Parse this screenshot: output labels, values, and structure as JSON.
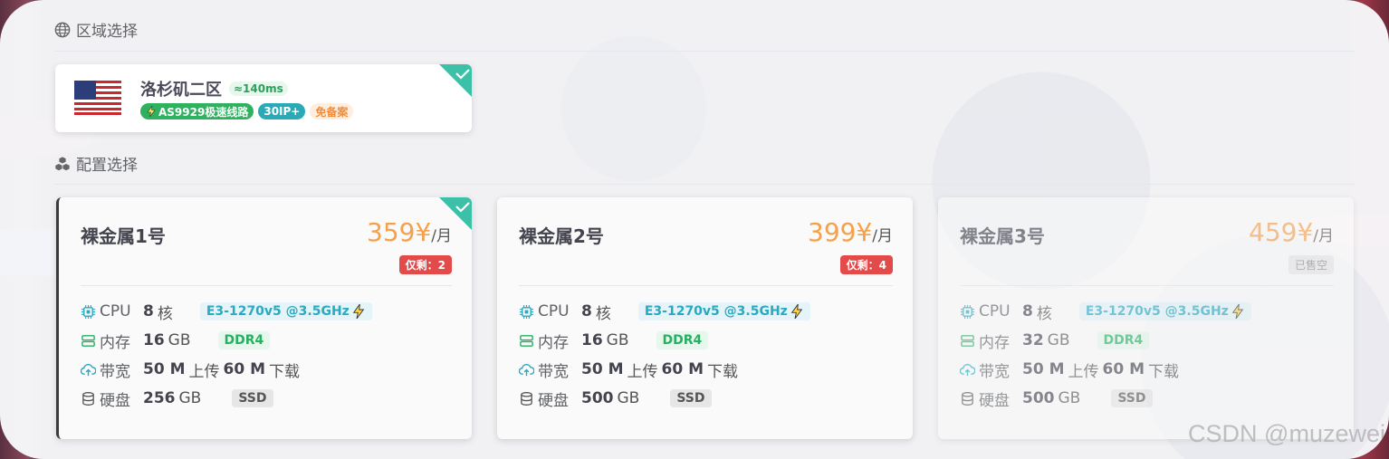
{
  "region_section": {
    "title": "区域选择",
    "icon": "globe-icon"
  },
  "region": {
    "name": "洛杉矶二区",
    "ping": "≈140ms",
    "tags": [
      "AS9929极速线路",
      "30IP+",
      "免备案"
    ],
    "flag": "us-flag"
  },
  "config_section": {
    "title": "配置选择",
    "icon": "cubes-icon"
  },
  "plans": [
    {
      "name": "裸金属1号",
      "price": "359¥",
      "unit": "/月",
      "stock": "仅剩：2",
      "cpu_label": "CPU",
      "cpu_val": "8",
      "cpu_unit": "核",
      "cpu_model": "E3-1270v5 @3.5GHz",
      "mem_label": "内存",
      "mem_val": "16",
      "mem_unit": "GB",
      "mem_type": "DDR4",
      "bw_label": "带宽",
      "bw_up": "50 M",
      "bw_up_text": "上传",
      "bw_down": "60 M",
      "bw_down_text": "下载",
      "disk_label": "硬盘",
      "disk_val": "256",
      "disk_unit": "GB",
      "disk_type": "SSD"
    },
    {
      "name": "裸金属2号",
      "price": "399¥",
      "unit": "/月",
      "stock": "仅剩：4",
      "cpu_label": "CPU",
      "cpu_val": "8",
      "cpu_unit": "核",
      "cpu_model": "E3-1270v5 @3.5GHz",
      "mem_label": "内存",
      "mem_val": "16",
      "mem_unit": "GB",
      "mem_type": "DDR4",
      "bw_label": "带宽",
      "bw_up": "50 M",
      "bw_up_text": "上传",
      "bw_down": "60 M",
      "bw_down_text": "下载",
      "disk_label": "硬盘",
      "disk_val": "500",
      "disk_unit": "GB",
      "disk_type": "SSD"
    },
    {
      "name": "裸金属3号",
      "price": "459¥",
      "unit": "/月",
      "stock": "已售空",
      "cpu_label": "CPU",
      "cpu_val": "8",
      "cpu_unit": "核",
      "cpu_model": "E3-1270v5 @3.5GHz",
      "mem_label": "内存",
      "mem_val": "32",
      "mem_unit": "GB",
      "mem_type": "DDR4",
      "bw_label": "带宽",
      "bw_up": "50 M",
      "bw_up_text": "上传",
      "bw_down": "60 M",
      "bw_down_text": "下载",
      "disk_label": "硬盘",
      "disk_val": "500",
      "disk_unit": "GB",
      "disk_type": "SSD"
    }
  ],
  "watermark": "CSDN @muzewei",
  "colors": {
    "accent": "#3cc0a8",
    "price": "#f5a04a",
    "stock": "#e34a4a"
  }
}
